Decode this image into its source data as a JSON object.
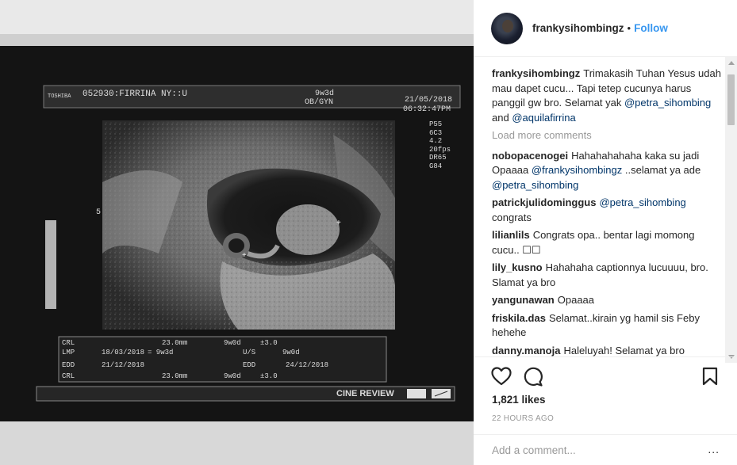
{
  "post": {
    "username": "frankysihombingz",
    "follow_label": "Follow",
    "separator": "•"
  },
  "photo": {
    "brand": "TOSHIBA",
    "patient": "052930:FIRRINA NY::U",
    "ga": "9w3d",
    "dept": "OB/GYN",
    "date": "21/05/2018",
    "time": "06:32:47PM",
    "params": [
      "P55",
      "6C3",
      "4.2",
      "20fps",
      "DR65",
      "G84"
    ],
    "scale_mark": "5",
    "meas": {
      "r1": [
        "CRL",
        "23.0mm",
        "9w0d",
        "±3.0"
      ],
      "r2": [
        "LMP",
        "18/03/2018",
        "= 9w3d",
        "U/S",
        "9w0d"
      ],
      "r3": [
        "EDD",
        "21/12/2018",
        "EDD",
        "24/12/2018"
      ],
      "r4": [
        "CRL",
        "23.0mm",
        "9w0d",
        "±3.0"
      ]
    },
    "cine": "CINE REVIEW"
  },
  "caption": {
    "text": "Trimakasih Tuhan Yesus udah mau dapet cucu... Tapi tetep cucunya harus panggil gw bro. Selamat yak",
    "mention1": "@petra_sihombing",
    "and": "and",
    "mention2": "@aquilafirrina"
  },
  "load_more": "Load more comments",
  "comments": [
    {
      "user": "nobopacenogei",
      "pre": "Hahahahahaha kaka su jadi Opaaaa",
      "mention": "@frankysihombingz",
      "post": " ..selamat ya ade",
      "mention2": "@petra_sihombing"
    },
    {
      "user": "patrickjulidominggus",
      "mention": "@petra_sihombing",
      "post": "congrats"
    },
    {
      "user": "lilianlils",
      "text": "Congrats opa.. bentar lagi momong cucu.. ☐☐"
    },
    {
      "user": "lily_kusno",
      "text": "Hahahaha captionnya lucuuuu, bro. Slamat ya bro"
    },
    {
      "user": "yangunawan",
      "text": "Opaaaa"
    },
    {
      "user": "friskila.das",
      "text": "Selamat..kirain yg hamil sis Feby hehehe"
    },
    {
      "user": "danny.manoja",
      "text": "Haleluyah! Selamat ya bro"
    }
  ],
  "likes": "1,821 likes",
  "time_ago": "22 HOURS AGO",
  "add_comment_placeholder": "Add a comment...",
  "more_options": "..."
}
